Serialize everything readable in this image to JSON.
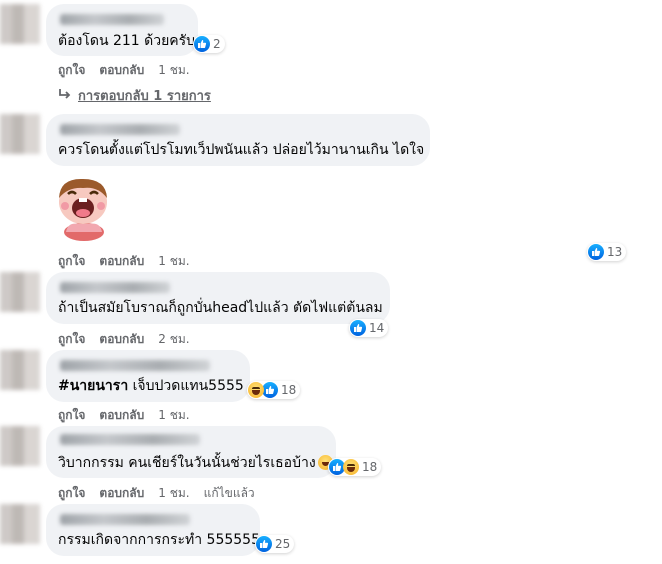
{
  "comments": [
    {
      "text": "ต้องโดน 211 ด้วยครับ",
      "reaction_count": "2",
      "actions": {
        "like": "ถูกใจ",
        "reply": "ตอบกลับ",
        "time": "1 ชม."
      }
    },
    {
      "text": "ควรโดนตั้งแต่โปรโมทเว็ปพนันแล้ว ปล่อยไว้มานานเกิน ไดใจ",
      "reaction_count": "13",
      "actions": {
        "like": "ถูกใจ",
        "reply": "ตอบกลับ",
        "time": "1 ชม."
      }
    },
    {
      "text": "ถ้าเป็นสมัยโบราณก็ถูกบั่นheadไปแล้ว ตัดไฟแต่ต้นลม",
      "reaction_count": "14",
      "actions": {
        "like": "ถูกใจ",
        "reply": "ตอบกลับ",
        "time": "2 ชม."
      }
    },
    {
      "hashtag": "#นายนารา",
      "text": " เจ็บปวดแทน5555",
      "reaction_count": "18",
      "actions": {
        "like": "ถูกใจ",
        "reply": "ตอบกลับ",
        "time": "1 ชม."
      }
    },
    {
      "text": "วิบากกรรม คนเชียร์ในวันนั้นช่วยไรเธอบ้าง",
      "reaction_count": "18",
      "actions": {
        "like": "ถูกใจ",
        "reply": "ตอบกลับ",
        "time": "1 ชม.",
        "edited": "แก้ไขแล้ว"
      }
    },
    {
      "text": "กรรมเกิดจากการกระทำ 555555",
      "reaction_count": "25"
    }
  ],
  "replies_link": "การตอบกลับ 1 รายการ",
  "colors": {
    "like_blue": "#0866ff",
    "bubble": "#f0f2f5",
    "meta": "#65676b"
  }
}
